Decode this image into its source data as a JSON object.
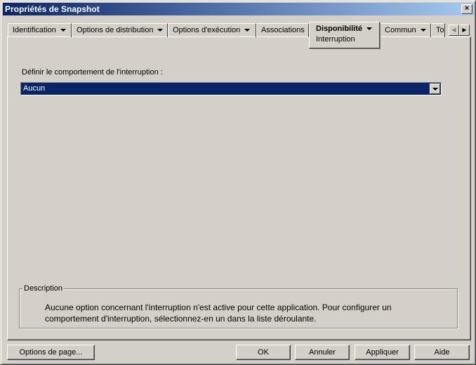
{
  "window": {
    "title": "Propriétés de Snapshot",
    "close": "×"
  },
  "tabs": [
    {
      "label": "Identification",
      "dropdown": true
    },
    {
      "label": "Options de distribution",
      "dropdown": true
    },
    {
      "label": "Options d'exécution",
      "dropdown": true
    },
    {
      "label": "Associations",
      "dropdown": false
    },
    {
      "label": "Disponibilité",
      "dropdown": true,
      "active": true,
      "subtab": "Interruption"
    },
    {
      "label": "Commun",
      "dropdown": true
    },
    {
      "label": "To",
      "dropdown": false
    }
  ],
  "tab_scroll": {
    "left": "◀",
    "right": "▶"
  },
  "content": {
    "label": "Définir le comportement de l'interruption :",
    "select_value": "Aucun"
  },
  "description": {
    "legend": "Description",
    "text": "Aucune option concernant l'interruption n'est active pour cette application. Pour configurer un comportement d'interruption, sélectionnez-en un dans la liste déroulante."
  },
  "buttons": {
    "page_options": "Options de page...",
    "ok": "OK",
    "cancel": "Annuler",
    "apply": "Appliquer",
    "help": "Aide"
  }
}
